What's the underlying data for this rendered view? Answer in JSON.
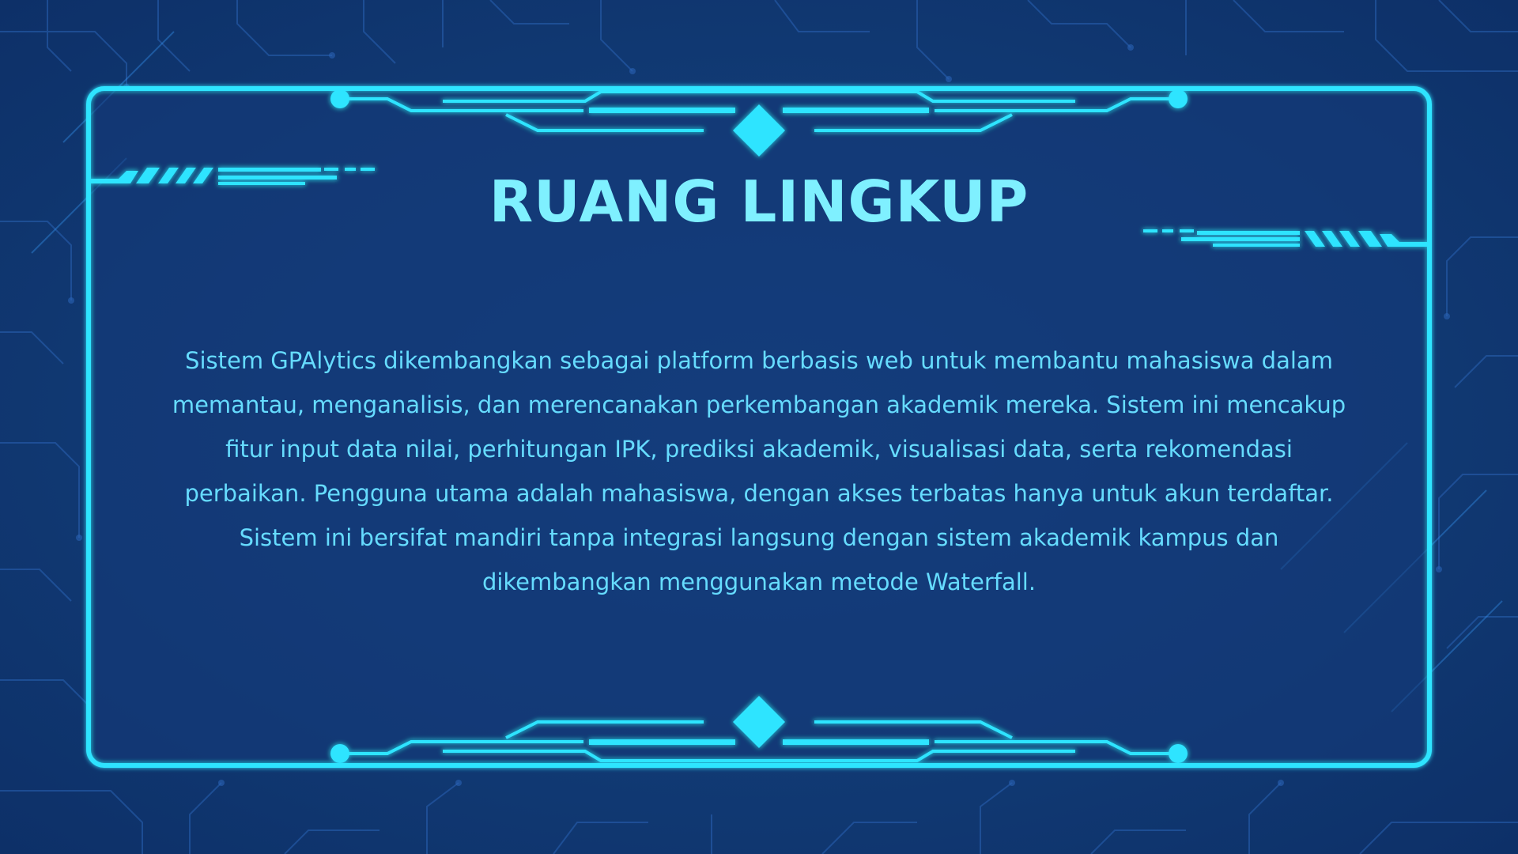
{
  "slide": {
    "title": "RUANG LINGKUP",
    "body": "Sistem GPAlytics dikembangkan sebagai platform berbasis web untuk membantu mahasiswa dalam memantau, menganalisis, dan merencanakan perkembangan akademik mereka. Sistem ini mencakup fitur input data nilai, perhitungan IPK, prediksi akademik, visualisasi data, serta rekomendasi perbaikan. Pengguna utama adalah mahasiswa, dengan akses terbatas hanya untuk akun terdaftar. Sistem ini bersifat mandiri tanpa integrasi langsung dengan sistem akademik kampus dan dikembangkan menggunakan metode Waterfall."
  },
  "colors": {
    "background": "#123a78",
    "frame_cyan": "#2fe4ff",
    "title": "#7ff0ff",
    "body_text": "#66dcff"
  }
}
